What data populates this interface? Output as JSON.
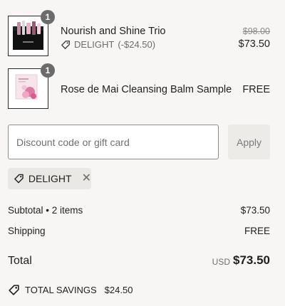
{
  "items": [
    {
      "name": "Nourish and Shine Trio",
      "quantity": "1",
      "discount_code": "DELIGHT",
      "discount_amount": "(-$24.50)",
      "original_price": "$98.00",
      "price": "$73.50",
      "image_icon": "gift-box-product-image"
    },
    {
      "name": "Rose de Mai Cleansing Balm Sample",
      "quantity": "1",
      "price": "FREE",
      "image_icon": "cleansing-balm-product-image"
    }
  ],
  "discount": {
    "placeholder": "Discount code or gift card",
    "value": "",
    "apply_label": "Apply",
    "applied_code": "DELIGHT"
  },
  "summary": {
    "subtotal_label": "Subtotal • 2 items",
    "subtotal_value": "$73.50",
    "shipping_label": "Shipping",
    "shipping_value": "FREE",
    "total_label": "Total",
    "total_currency": "USD",
    "total_value": "$73.50",
    "savings_label": "TOTAL SAVINGS",
    "savings_value": "$24.50"
  },
  "colors": {
    "background": "#f7f6f4",
    "qty_badge": "#6b6b6b",
    "chip_bg": "#e9e8e5",
    "button_bg": "#ecebe8"
  }
}
